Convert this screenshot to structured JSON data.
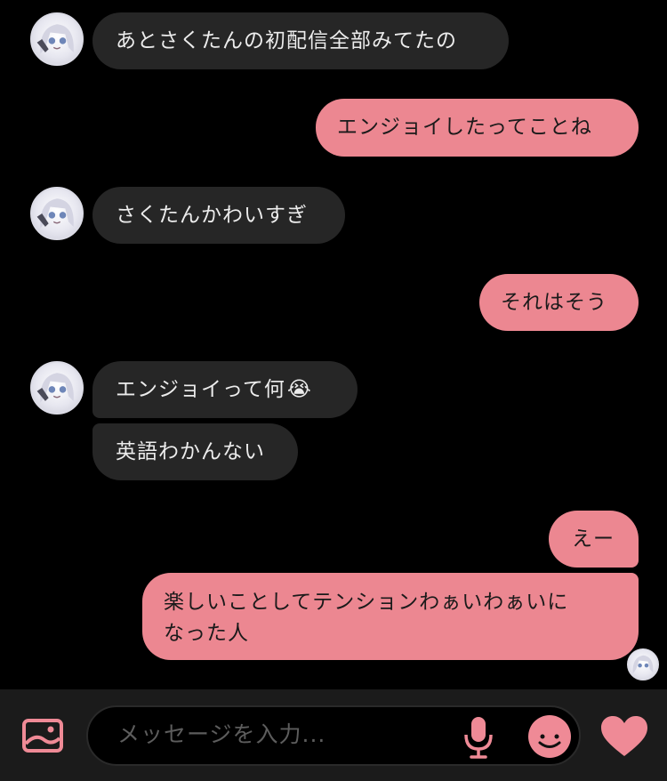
{
  "messages": [
    {
      "side": "in",
      "text": "あとさくたんの初配信全部みてたの"
    },
    {
      "side": "out",
      "text": "エンジョイしたってことね"
    },
    {
      "side": "in",
      "text": "さくたんかわいすぎ"
    },
    {
      "side": "out",
      "text": "それはそう"
    },
    {
      "side": "in",
      "text": "エンジョイって何",
      "emoji": "😭"
    },
    {
      "side": "in",
      "text": "英語わかんない"
    },
    {
      "side": "out",
      "text": "えー"
    },
    {
      "side": "out",
      "lines": [
        "楽しいことしてテンションわぁいわぁいに",
        "なった人"
      ]
    }
  ],
  "composer": {
    "placeholder": "メッセージを入力..."
  },
  "colors": {
    "background": "#000000",
    "incoming": "#262626",
    "outgoing": "#ec8791",
    "accent": "#ef8a96",
    "bar": "#1b1b1b"
  },
  "icons": {
    "attach": "image-icon",
    "voice": "mic-icon",
    "sticker": "smile-icon",
    "like": "heart-icon"
  }
}
